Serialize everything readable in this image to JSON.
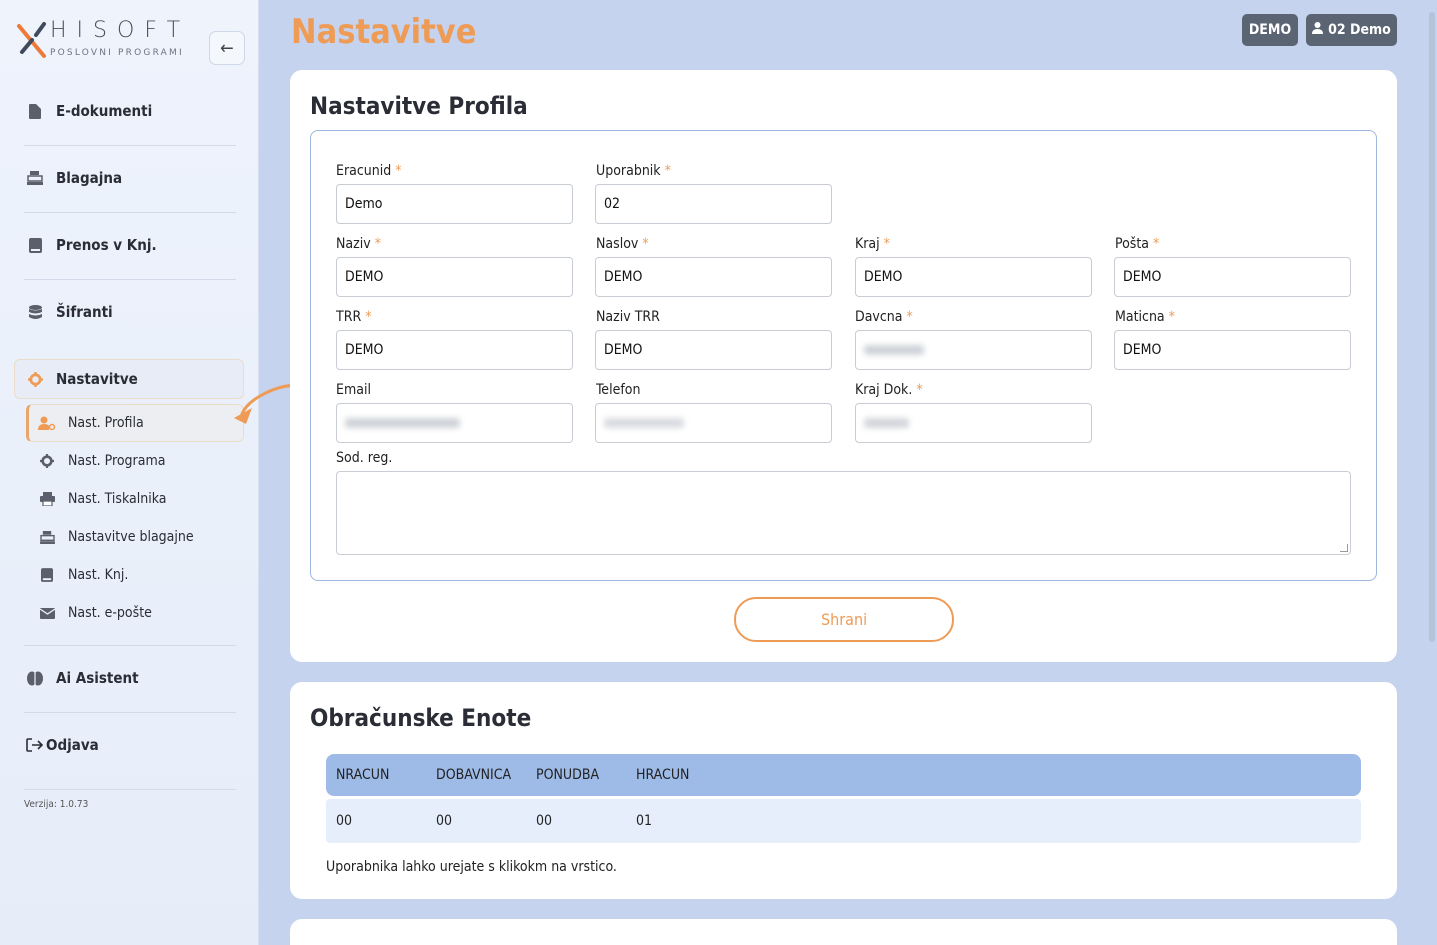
{
  "brand": {
    "name": "HISOFT",
    "tagline": "POSLOVNI PROGRAMI"
  },
  "sidebar": {
    "items": [
      {
        "label": "E-dokumenti",
        "icon": "file-icon"
      },
      {
        "label": "Blagajna",
        "icon": "cash-register-icon"
      },
      {
        "label": "Prenos v Knj.",
        "icon": "book-icon"
      },
      {
        "label": "Šifranti",
        "icon": "database-icon"
      },
      {
        "label": "Nastavitve",
        "icon": "gear-icon"
      }
    ],
    "sub_items": [
      {
        "label": "Nast. Profila",
        "icon": "user-gear-icon"
      },
      {
        "label": "Nast. Programa",
        "icon": "gear-icon"
      },
      {
        "label": "Nast. Tiskalnika",
        "icon": "printer-icon"
      },
      {
        "label": "Nastavitve blagajne",
        "icon": "cash-register-icon"
      },
      {
        "label": "Nast. Knj.",
        "icon": "book-icon"
      },
      {
        "label": "Nast. e-pošte",
        "icon": "envelope-icon"
      }
    ],
    "ai": {
      "label": "Ai Asistent",
      "icon": "brain-icon"
    },
    "logout": {
      "label": "Odjava",
      "icon": "logout-icon"
    },
    "version": "Verzija: 1.0.73"
  },
  "header": {
    "title": "Nastavitve",
    "company_badge": "DEMO",
    "user_badge": "02 Demo"
  },
  "profile": {
    "title": "Nastavitve Profila",
    "fields": {
      "eracunid": {
        "label": "Eracunid",
        "value": "Demo"
      },
      "uporabnik": {
        "label": "Uporabnik",
        "value": "02"
      },
      "naziv": {
        "label": "Naziv",
        "value": "DEMO"
      },
      "naslov": {
        "label": "Naslov",
        "value": "DEMO"
      },
      "kraj": {
        "label": "Kraj",
        "value": "DEMO"
      },
      "posta": {
        "label": "Pošta",
        "value": "DEMO"
      },
      "trr": {
        "label": "TRR",
        "value": "DEMO"
      },
      "naziv_trr": {
        "label": "Naziv TRR",
        "value": "DEMO"
      },
      "davcna": {
        "label": "Davcna",
        "value": ""
      },
      "maticna": {
        "label": "Maticna",
        "value": "DEMO"
      },
      "email": {
        "label": "Email",
        "value": ""
      },
      "telefon": {
        "label": "Telefon",
        "value": ""
      },
      "kraj_dok": {
        "label": "Kraj Dok.",
        "value": ""
      },
      "sod_reg": {
        "label": "Sod. reg.",
        "value": ""
      }
    },
    "required_mark": "*",
    "save_label": "Shrani"
  },
  "units": {
    "title": "Obračunske Enote",
    "columns": [
      "NRACUN",
      "DOBAVNICA",
      "PONUDBA",
      "HRACUN"
    ],
    "rows": [
      [
        "00",
        "00",
        "00",
        "01"
      ]
    ],
    "note": "Uporabnika lahko urejate s klikokm na vrstico."
  },
  "colors": {
    "accent": "#ee9b56",
    "background": "#c5d3ee",
    "table_header": "#9ebbe8",
    "badge": "#5b6472"
  }
}
